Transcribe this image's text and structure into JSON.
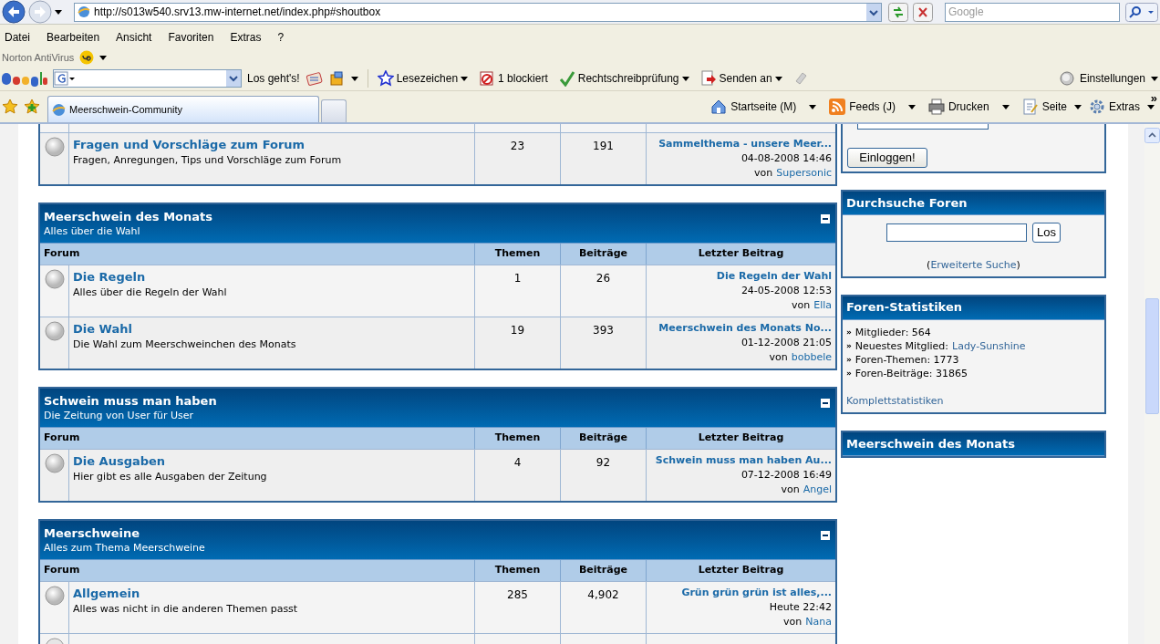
{
  "browser": {
    "address": "http://s013w540.srv13.mw-internet.net/index.php#shoutbox",
    "search_placeholder": "Google",
    "menu": [
      "Datei",
      "Bearbeiten",
      "Ansicht",
      "Favoriten",
      "Extras",
      "?"
    ],
    "norton_label": "Norton AntiVirus",
    "google_button": "Los geht's!",
    "google_items": [
      {
        "kind": "bookmark",
        "label": "Lesezeichen"
      },
      {
        "kind": "popup",
        "label": "1 blockiert"
      },
      {
        "kind": "spell",
        "label": "Rechtschreibprüfung"
      },
      {
        "kind": "send",
        "label": "Senden an"
      }
    ],
    "settings_label": "Einstellungen",
    "tab_title": "Meerschwein-Community",
    "commands": [
      {
        "kind": "home",
        "label": "Startseite (M)"
      },
      {
        "kind": "feeds",
        "label": "Feeds (J)"
      },
      {
        "kind": "print",
        "label": "Drucken"
      },
      {
        "kind": "page",
        "label": "Seite"
      },
      {
        "kind": "tools",
        "label": "Extras"
      }
    ],
    "more": "»"
  },
  "categories": [
    {
      "rows": [
        {
          "name": "Fragen und Vorschläge zum Forum",
          "description": "Fragen, Anregungen, Tips und Vorschläge zum Forum",
          "topics": "23",
          "posts": "191",
          "last_title": "Sammelthema - unsere Meer...",
          "last_date": "04-08-2008 14:46",
          "last_by": "von",
          "last_user": "Supersonic"
        }
      ]
    },
    {
      "title": "Meerschwein des Monats",
      "description": "Alles über die Wahl",
      "columns": [
        "Forum",
        "Themen",
        "Beiträge",
        "Letzter Beitrag"
      ],
      "rows": [
        {
          "name": "Die Regeln",
          "description": "Alles über die Regeln der Wahl",
          "topics": "1",
          "posts": "26",
          "last_title": "Die Regeln der Wahl",
          "last_date": "24-05-2008 12:53",
          "last_by": "von",
          "last_user": "Ella"
        },
        {
          "name": "Die Wahl",
          "description": "Die Wahl zum Meerschweinchen des Monats",
          "topics": "19",
          "posts": "393",
          "last_title": "Meerschwein des Monats No...",
          "last_date": "01-12-2008 21:05",
          "last_by": "von",
          "last_user": "bobbele"
        }
      ]
    },
    {
      "title": "Schwein muss man haben",
      "description": "Die Zeitung von User für User",
      "columns": [
        "Forum",
        "Themen",
        "Beiträge",
        "Letzter Beitrag"
      ],
      "rows": [
        {
          "name": "Die Ausgaben",
          "description": "Hier gibt es alle Ausgaben der Zeitung",
          "topics": "4",
          "posts": "92",
          "last_title": "Schwein muss man haben Au...",
          "last_date": "07-12-2008 16:49",
          "last_by": "von",
          "last_user": "Angel"
        }
      ]
    },
    {
      "title": "Meerschweine",
      "description": "Alles zum Thema Meerschweine",
      "columns": [
        "Forum",
        "Themen",
        "Beiträge",
        "Letzter Beitrag"
      ],
      "rows": [
        {
          "name": "Allgemein",
          "description": "Alles was nicht in die anderen Themen passt",
          "topics": "285",
          "posts": "4,902",
          "last_title": "Grün grün grün ist alles,...",
          "last_date": "Heute 22:42",
          "last_by": "von",
          "last_user": "Nana"
        }
      ],
      "cut_row": true
    }
  ],
  "sidebar": {
    "login_button": "Einloggen!",
    "search": {
      "title": "Durchsuche Foren",
      "button": "Los",
      "open": "(",
      "link": "Erweiterte Suche",
      "close": ")"
    },
    "stats": {
      "title": "Foren-Statistiken",
      "items": [
        {
          "label": "Mitglieder: 564"
        },
        {
          "label": "Neuestes Mitglied:",
          "link": "Lady-Sunshine"
        },
        {
          "label": "Foren-Themen: 1773"
        },
        {
          "label": "Foren-Beiträge: 31865"
        }
      ],
      "bullet": "»",
      "link": "Komplettstatistiken"
    },
    "month": {
      "title": "Meerschwein des Monats"
    }
  }
}
